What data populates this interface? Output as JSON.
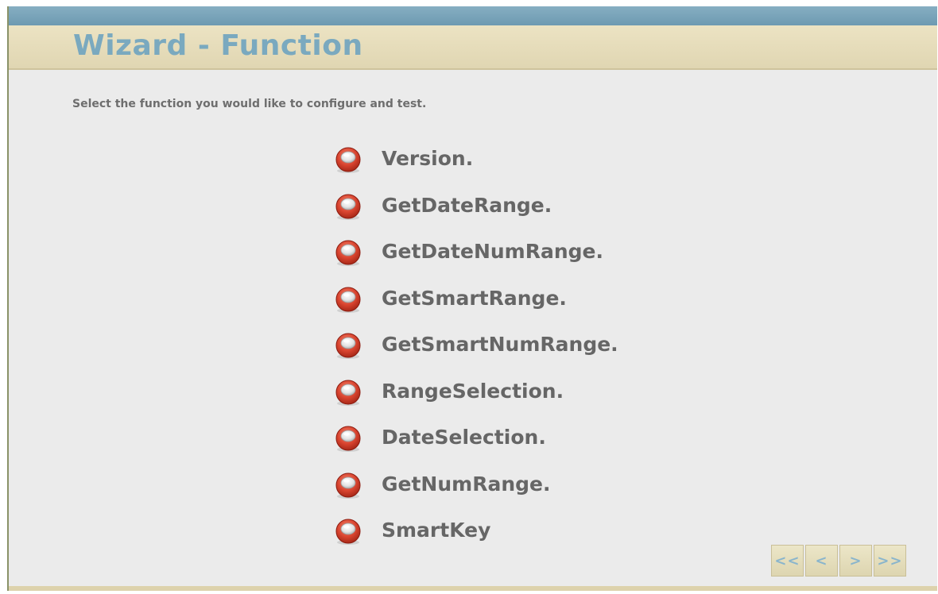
{
  "header": {
    "title": "Wizard - Function"
  },
  "instruction": "Select the function you would like to configure and test.",
  "functions": [
    {
      "label": "Version.",
      "icon": "radio-icon"
    },
    {
      "label": "GetDateRange.",
      "icon": "radio-icon"
    },
    {
      "label": "GetDateNumRange.",
      "icon": "radio-icon"
    },
    {
      "label": "GetSmartRange.",
      "icon": "radio-icon"
    },
    {
      "label": "GetSmartNumRange.",
      "icon": "radio-icon"
    },
    {
      "label": "RangeSelection.",
      "icon": "radio-icon"
    },
    {
      "label": "DateSelection.",
      "icon": "radio-icon"
    },
    {
      "label": "GetNumRange.",
      "icon": "radio-icon"
    },
    {
      "label": "SmartKey",
      "icon": "radio-icon"
    }
  ],
  "nav": {
    "first_label": "<<",
    "prev_label": "<",
    "next_label": ">",
    "last_label": ">>"
  },
  "colors": {
    "title": "#7aa9bf",
    "topbar": "#7aa3b8",
    "header_bg": "#e6dcb9",
    "body_bg": "#ebebeb",
    "radio_red": "#d94a36",
    "text_gray": "#666666"
  }
}
